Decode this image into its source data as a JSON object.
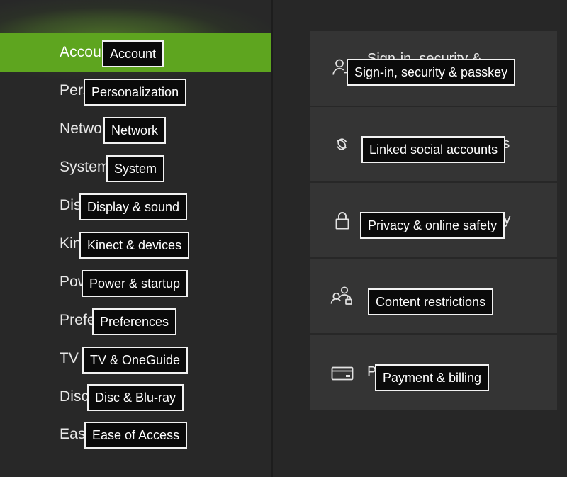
{
  "sidebar": {
    "items": [
      {
        "label": "Account",
        "overlay": "Account",
        "selected": true
      },
      {
        "label": "Personalization",
        "overlay": "Personalization",
        "selected": false
      },
      {
        "label": "Network",
        "overlay": "Network",
        "selected": false
      },
      {
        "label": "System",
        "overlay": "System",
        "selected": false
      },
      {
        "label": "Display & sound",
        "overlay": "Display & sound",
        "selected": false
      },
      {
        "label": "Kinect & devices",
        "overlay": "Kinect & devices",
        "selected": false
      },
      {
        "label": "Power & startup",
        "overlay": "Power & startup",
        "selected": false
      },
      {
        "label": "Preferences",
        "overlay": "Preferences",
        "selected": false
      },
      {
        "label": "TV & OneGuide",
        "overlay": "TV & OneGuide",
        "selected": false
      },
      {
        "label": "Disc & Blu-ray",
        "overlay": "Disc & Blu-ray",
        "selected": false
      },
      {
        "label": "Ease of Access",
        "overlay": "Ease of Access",
        "selected": false
      }
    ],
    "selection_color": "#5EA51F"
  },
  "detail": {
    "rows": [
      {
        "icon": "sign-in-icon",
        "line1": "Sign-in, security &",
        "line2": "passkey",
        "overlay": "Sign-in, security & passkey"
      },
      {
        "icon": "link-icon",
        "line1": "Linked social accounts",
        "line2": "",
        "overlay": "Linked social accounts"
      },
      {
        "icon": "lock-icon",
        "line1": "Privacy & online safety",
        "line2": "",
        "overlay": "Privacy & online safety"
      },
      {
        "icon": "people-lock-icon",
        "line1": "Content restrictions",
        "line2": "",
        "overlay": "Content restrictions"
      },
      {
        "icon": "credit-card-icon",
        "line1": "Payment & billing",
        "line2": "",
        "overlay": "Payment & billing"
      }
    ]
  },
  "colors": {
    "background": "#272727",
    "sidebar": "#282828",
    "panel_row": "#343434",
    "accent_green": "#5EA51F",
    "overlay_fill": "#0a0a0a",
    "overlay_border": "#f2f2f2",
    "text": "#e9e9e9"
  }
}
